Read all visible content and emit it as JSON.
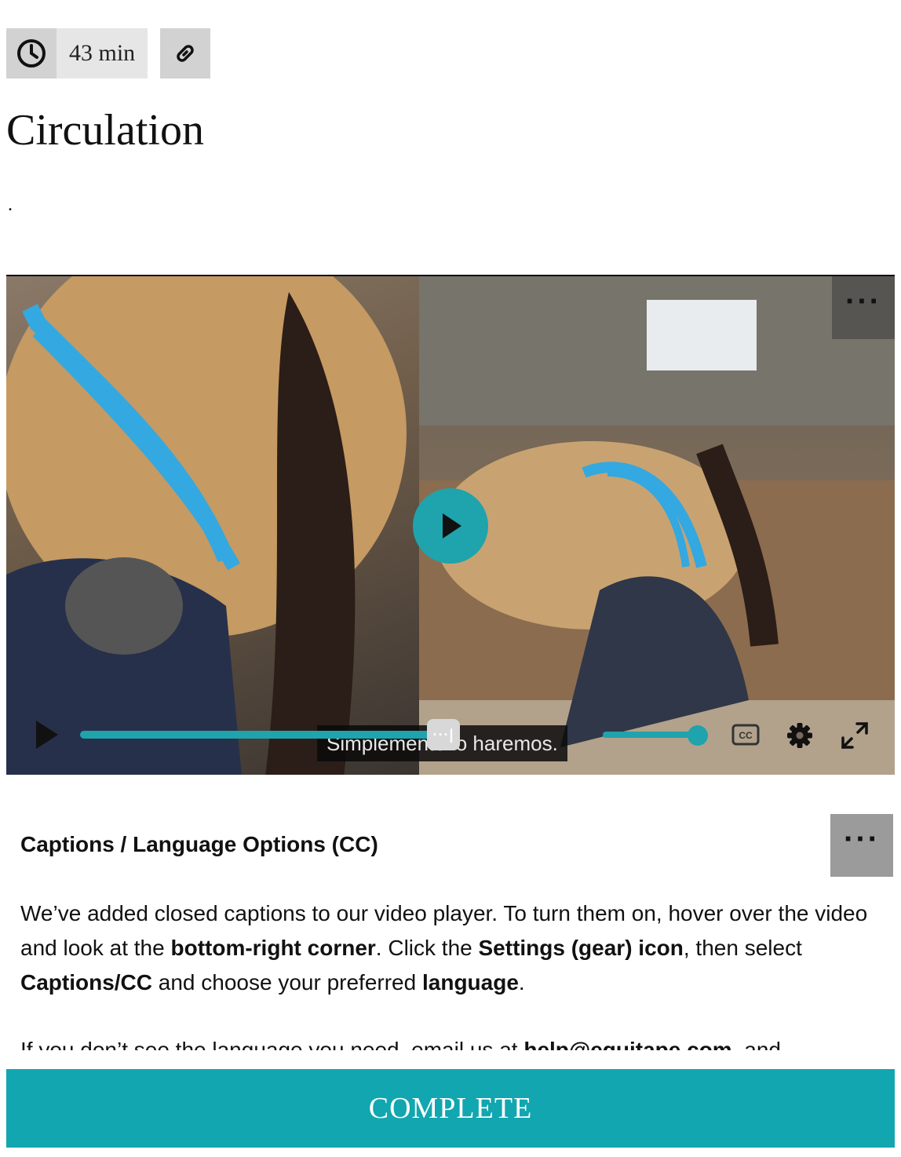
{
  "meta": {
    "duration": "43 min"
  },
  "lesson": {
    "title": "Circulation",
    "dot": "."
  },
  "video": {
    "caption_text": "Simplemente lo haremos.",
    "more_label": "···",
    "progress": 0.96,
    "volume": 1.0
  },
  "captions_section": {
    "heading": "Captions / Language Options (CC)",
    "more_label": "···",
    "p1_a": "We’ve added closed captions to our video player. To turn them on, hover over the video and look at the ",
    "p1_b": "bottom-right corner",
    "p1_c": ". Click the ",
    "p1_d": "Settings (gear) icon",
    "p1_e": ", then select ",
    "p1_f": "Captions/CC",
    "p1_g": " and choose your preferred ",
    "p1_h": "language",
    "p1_i": ".",
    "p2_a": "If you don’t see the language you need, email us at ",
    "p2_b": "help@equitape.com",
    "p2_c": ", and"
  },
  "footer": {
    "complete_label": "COMPLETE"
  },
  "colors": {
    "accent": "#12a6b0",
    "player_accent": "#1fa3ad"
  }
}
